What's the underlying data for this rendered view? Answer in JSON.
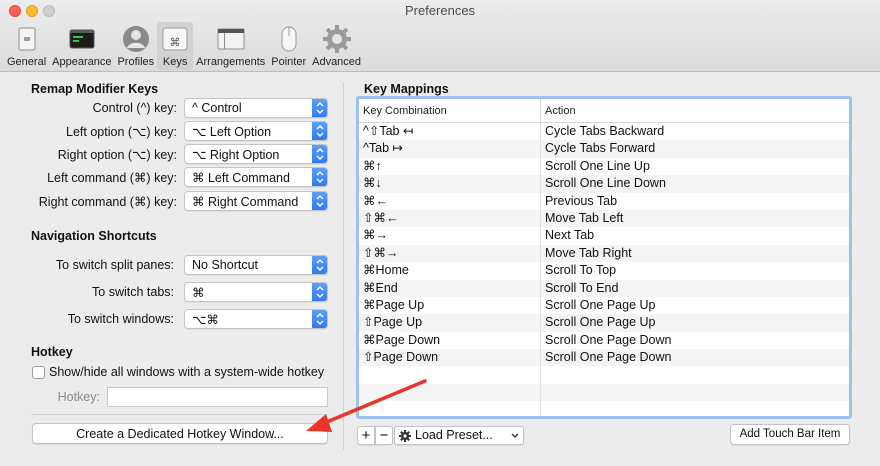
{
  "window": {
    "title": "Preferences"
  },
  "toolbar": {
    "items": [
      {
        "label": "General",
        "icon": "general-icon"
      },
      {
        "label": "Appearance",
        "icon": "appearance-icon"
      },
      {
        "label": "Profiles",
        "icon": "profiles-icon"
      },
      {
        "label": "Keys",
        "icon": "keys-icon",
        "selected": true
      },
      {
        "label": "Arrangements",
        "icon": "arrangements-icon"
      },
      {
        "label": "Pointer",
        "icon": "pointer-icon"
      },
      {
        "label": "Advanced",
        "icon": "advanced-icon"
      }
    ]
  },
  "remap": {
    "title": "Remap Modifier Keys",
    "rows": [
      {
        "label": "Control (^) key:",
        "value": "^ Control"
      },
      {
        "label": "Left option (⌥) key:",
        "value": "⌥ Left Option"
      },
      {
        "label": "Right option (⌥) key:",
        "value": "⌥ Right Option"
      },
      {
        "label": "Left command (⌘) key:",
        "value": "⌘ Left Command"
      },
      {
        "label": "Right command (⌘) key:",
        "value": "⌘ Right Command"
      }
    ]
  },
  "nav": {
    "title": "Navigation Shortcuts",
    "rows": [
      {
        "label": "To switch split panes:",
        "value": "No Shortcut"
      },
      {
        "label": "To switch tabs:",
        "value": "⌘"
      },
      {
        "label": "To switch windows:",
        "value": "⌥⌘"
      }
    ]
  },
  "hotkey": {
    "title": "Hotkey",
    "checkbox_label": "Show/hide all windows with a system-wide hotkey",
    "checked": false,
    "field_label": "Hotkey:",
    "field_value": "",
    "create_button": "Create a Dedicated Hotkey Window..."
  },
  "mappings": {
    "title": "Key Mappings",
    "columns": [
      "Key Combination",
      "Action"
    ],
    "rows": [
      [
        "^⇧Tab ↤",
        "Cycle Tabs Backward"
      ],
      [
        "^Tab ↦",
        "Cycle Tabs Forward"
      ],
      [
        "⌘↑",
        "Scroll One Line Up"
      ],
      [
        "⌘↓",
        "Scroll One Line Down"
      ],
      [
        "⌘←",
        "Previous Tab"
      ],
      [
        "⇧⌘←",
        "Move Tab Left"
      ],
      [
        "⌘→",
        "Next Tab"
      ],
      [
        "⇧⌘→",
        "Move Tab Right"
      ],
      [
        "⌘Home",
        "Scroll To Top"
      ],
      [
        "⌘End",
        "Scroll To End"
      ],
      [
        "⌘Page Up",
        "Scroll One Page Up"
      ],
      [
        "⇧Page Up",
        "Scroll One Page Up"
      ],
      [
        "⌘Page Down",
        "Scroll One Page Down"
      ],
      [
        "⇧Page Down",
        "Scroll One Page Down"
      ],
      [
        "",
        ""
      ],
      [
        "",
        ""
      ],
      [
        "",
        ""
      ]
    ],
    "add_label": "+",
    "remove_label": "−",
    "load_preset": "Load Preset...",
    "touch_bar_button": "Add Touch Bar Item"
  },
  "colors": {
    "accent": "#2f78ee",
    "annotation_arrow": "#e8352a"
  }
}
